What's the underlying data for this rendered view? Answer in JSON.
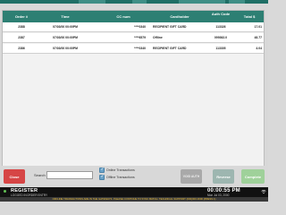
{
  "table": {
    "headers": [
      "Order #",
      "Time",
      "CC num",
      "Cardholder",
      "Auth Code",
      "Total $"
    ],
    "rows": [
      {
        "order": "2388",
        "time": "07/03/00 00:00PM",
        "cc": "****0340",
        "cardholder": "RECIPIENT GIFT CARD",
        "auth": "113326",
        "total": "17.01"
      },
      {
        "order": "2387",
        "time": "07/03/00 00:00PM",
        "cc": "****6579",
        "cardholder": "Offline",
        "auth": "099362.0",
        "total": "48.77"
      },
      {
        "order": "2386",
        "time": "07/03/00 00:00PM",
        "cc": "****0340",
        "cardholder": "RECIPIENT GIFT CARD",
        "auth": "113305",
        "total": "4.04"
      }
    ]
  },
  "controls": {
    "close_label": "Close",
    "search_label": "Search",
    "search_value": "",
    "online_label": "Online Transactions",
    "offline_label": "Offline Transactions",
    "void_label": "VOID AUTH",
    "reverse_label": "Reverse",
    "complete_label": "Complete"
  },
  "footer": {
    "mode": "REGISTER",
    "user": "LOGGED IN",
    "user2": "ORDER ENTRY",
    "time": "00:00:55 PM",
    "date": "Mon Jul 03, 2000",
    "banner": "OFFLINE TRANSACTIONS ARE IN THE GATEWAYS. PLEASE CONTINUE TO SYNC BATCH. TECHNICAL SUPPORT (000)000-0000 (PRESS 1)"
  },
  "colors": {
    "header_bg": "#2d7f73",
    "footer_bg": "#111111",
    "close_btn": "#d64545",
    "status_dot": "#62c154"
  }
}
